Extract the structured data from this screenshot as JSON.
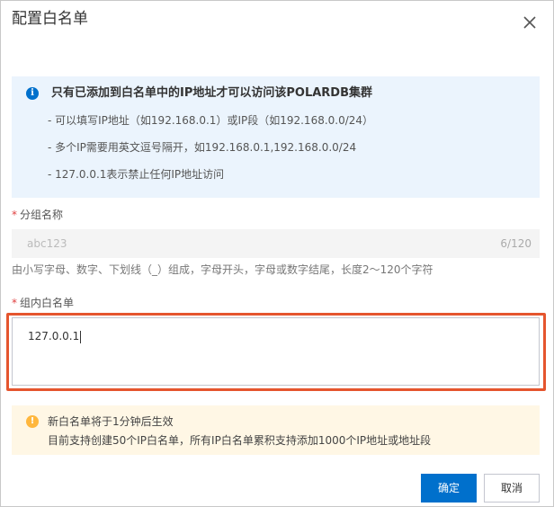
{
  "dialog": {
    "title": "配置白名单",
    "close_icon": "close-icon"
  },
  "info": {
    "icon": "info-icon",
    "icon_glyph": "i",
    "title": "只有已添加到白名单中的IP地址才可以访问该POLARDB集群",
    "lines": [
      "- 可以填写IP地址（如192.168.0.1）或IP段（如192.168.0.0/24）",
      "- 多个IP需要用英文逗号隔开，如192.168.0.1,192.168.0.0/24",
      "- 127.0.0.1表示禁止任何IP地址访问"
    ]
  },
  "group_name": {
    "required_mark": "*",
    "label": "分组名称",
    "value": "abc123",
    "count": "6/120",
    "help": "由小写字母、数字、下划线（_）组成，字母开头，字母或数字结尾，长度2～120个字符"
  },
  "whitelist": {
    "required_mark": "*",
    "label": "组内白名单",
    "value": "127.0.0.1"
  },
  "warning": {
    "icon": "warning-icon",
    "icon_glyph": "!",
    "lines": [
      "新白名单将于1分钟后生效",
      "目前支持创建50个IP白名单，所有IP白名单累积支持添加1000个IP地址或地址段"
    ]
  },
  "footer": {
    "confirm_label": "确定",
    "cancel_label": "取消"
  },
  "colors": {
    "primary": "#0070cc",
    "highlight": "#e5552e",
    "info_bg": "#ebf4fd",
    "warn_bg": "#fff7e5",
    "warn_icon": "#ffb73d",
    "required": "#e04040"
  }
}
